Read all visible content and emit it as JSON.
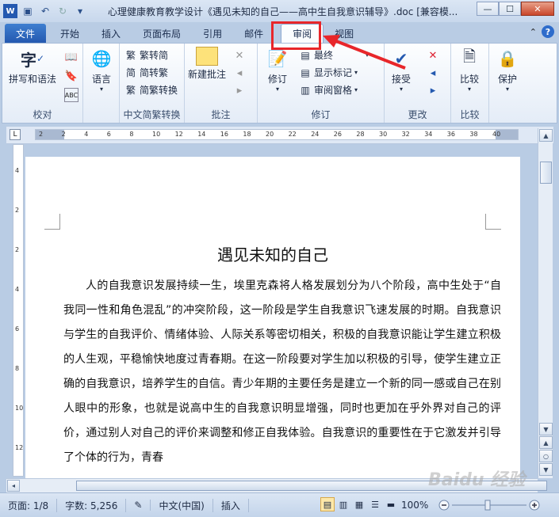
{
  "window": {
    "title": "心理健康教育教学设计《遇见未知的自己——高中生自我意识辅导》.doc [兼容模...",
    "minimize_icon": "minimize-icon",
    "maximize_icon": "maximize-icon",
    "close_icon": "close-icon",
    "minimize": "—",
    "maximize": "☐",
    "close": "✕"
  },
  "tabs": {
    "file": "文件",
    "items": [
      "开始",
      "插入",
      "页面布局",
      "引用",
      "邮件",
      "审阅",
      "视图"
    ],
    "active": "审阅"
  },
  "ribbon": {
    "proofing": {
      "label": "校对",
      "spell": "拼写和语法",
      "language": "语言"
    },
    "chinese": {
      "label": "中文简繁转换",
      "t2s": "繁转简",
      "s2t": "简转繁",
      "convert": "简繁转换"
    },
    "comments": {
      "label": "批注",
      "new": "新建批注"
    },
    "tracking": {
      "label": "修订",
      "track": "修订",
      "final": "最终",
      "show_markup": "显示标记",
      "review_pane": "审阅窗格"
    },
    "changes": {
      "label": "更改",
      "accept": "接受"
    },
    "compare": {
      "label": "比较",
      "compare": "比较"
    },
    "protect": {
      "label": "",
      "protect": "保护"
    }
  },
  "ruler": {
    "marks": [
      "2",
      "2",
      "4",
      "6",
      "8",
      "10",
      "12",
      "14",
      "16",
      "18",
      "20",
      "22",
      "24",
      "26",
      "28",
      "30",
      "32",
      "34",
      "36",
      "38",
      "40"
    ],
    "vmarks": [
      "4",
      "2",
      "2",
      "4",
      "6",
      "8",
      "10",
      "12"
    ]
  },
  "document": {
    "title": "遇见未知的自己",
    "paragraph": "人的自我意识发展持续一生，埃里克森将人格发展划分为八个阶段，高中生处于“自我同一性和角色混乱”的冲突阶段，这一阶段是学生自我意识飞速发展的时期。自我意识与学生的自我评价、情绪体验、人际关系等密切相关，积极的自我意识能让学生建立积极的人生观，平稳愉快地度过青春期。在这一阶段要对学生加以积极的引导，使学生建立正确的自我意识，培养学生的自信。青少年期的主要任务是建立一个新的同一感或自己在别人眼中的形象，也就是说高中生的自我意识明显增强，同时也更加在乎外界对自己的评价，通过别人对自己的评价来调整和修正自我体验。自我意识的重要性在于它激发并引导了个体的行为，青春"
  },
  "status": {
    "page": "页面: 1/8",
    "words": "字数: 5,256",
    "language": "中文(中国)",
    "mode": "插入",
    "zoom": "100%"
  },
  "watermark": "Baidu 经验",
  "colors": {
    "accent": "#2459b0",
    "highlight": "#e8262a"
  }
}
